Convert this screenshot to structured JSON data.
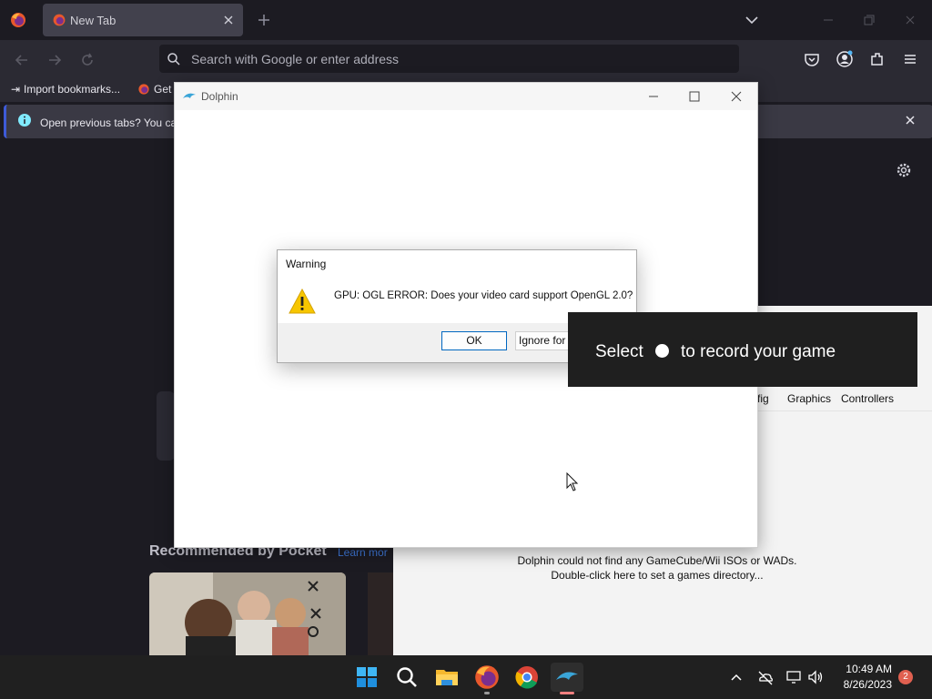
{
  "browser": {
    "tab": {
      "title": "New Tab"
    },
    "address_bar": {
      "placeholder": "Search with Google or enter address"
    },
    "bookmarks": [
      {
        "label": "Import bookmarks..."
      },
      {
        "label": "Get"
      }
    ],
    "notification": {
      "text": "Open previous tabs? You ca"
    },
    "pocket": {
      "title": "Recommended by Pocket",
      "learn_more": "Learn mor"
    }
  },
  "dolphin_window": {
    "title": "Dolphin"
  },
  "dolphin_main": {
    "toolbar": [
      {
        "label": "fig"
      },
      {
        "label": "Graphics"
      },
      {
        "label": "Controllers"
      }
    ],
    "message_line1": "Dolphin could not find any GameCube/Wii ISOs or WADs.",
    "message_line2": "Double-click here to set a games directory..."
  },
  "warning_dialog": {
    "title": "Warning",
    "message": "GPU: OGL ERROR: Does your video card support OpenGL 2.0?",
    "ok_label": "OK",
    "ignore_label": "Ignore for"
  },
  "gamebar_toast": {
    "text_before": "Select",
    "text_after": "to record your game"
  },
  "taskbar": {
    "apps": [
      "start-icon",
      "search-icon",
      "file-explorer-icon",
      "firefox-icon",
      "chrome-icon",
      "dolphin-icon"
    ],
    "time": "10:49 AM",
    "date": "8/26/2023",
    "notification_count": "2"
  },
  "colors": {
    "firefox_bg": "#1c1b22",
    "toolbar_bg": "#2b2a33",
    "accent_blue": "#0067c0",
    "taskbar_bg": "#202020"
  }
}
